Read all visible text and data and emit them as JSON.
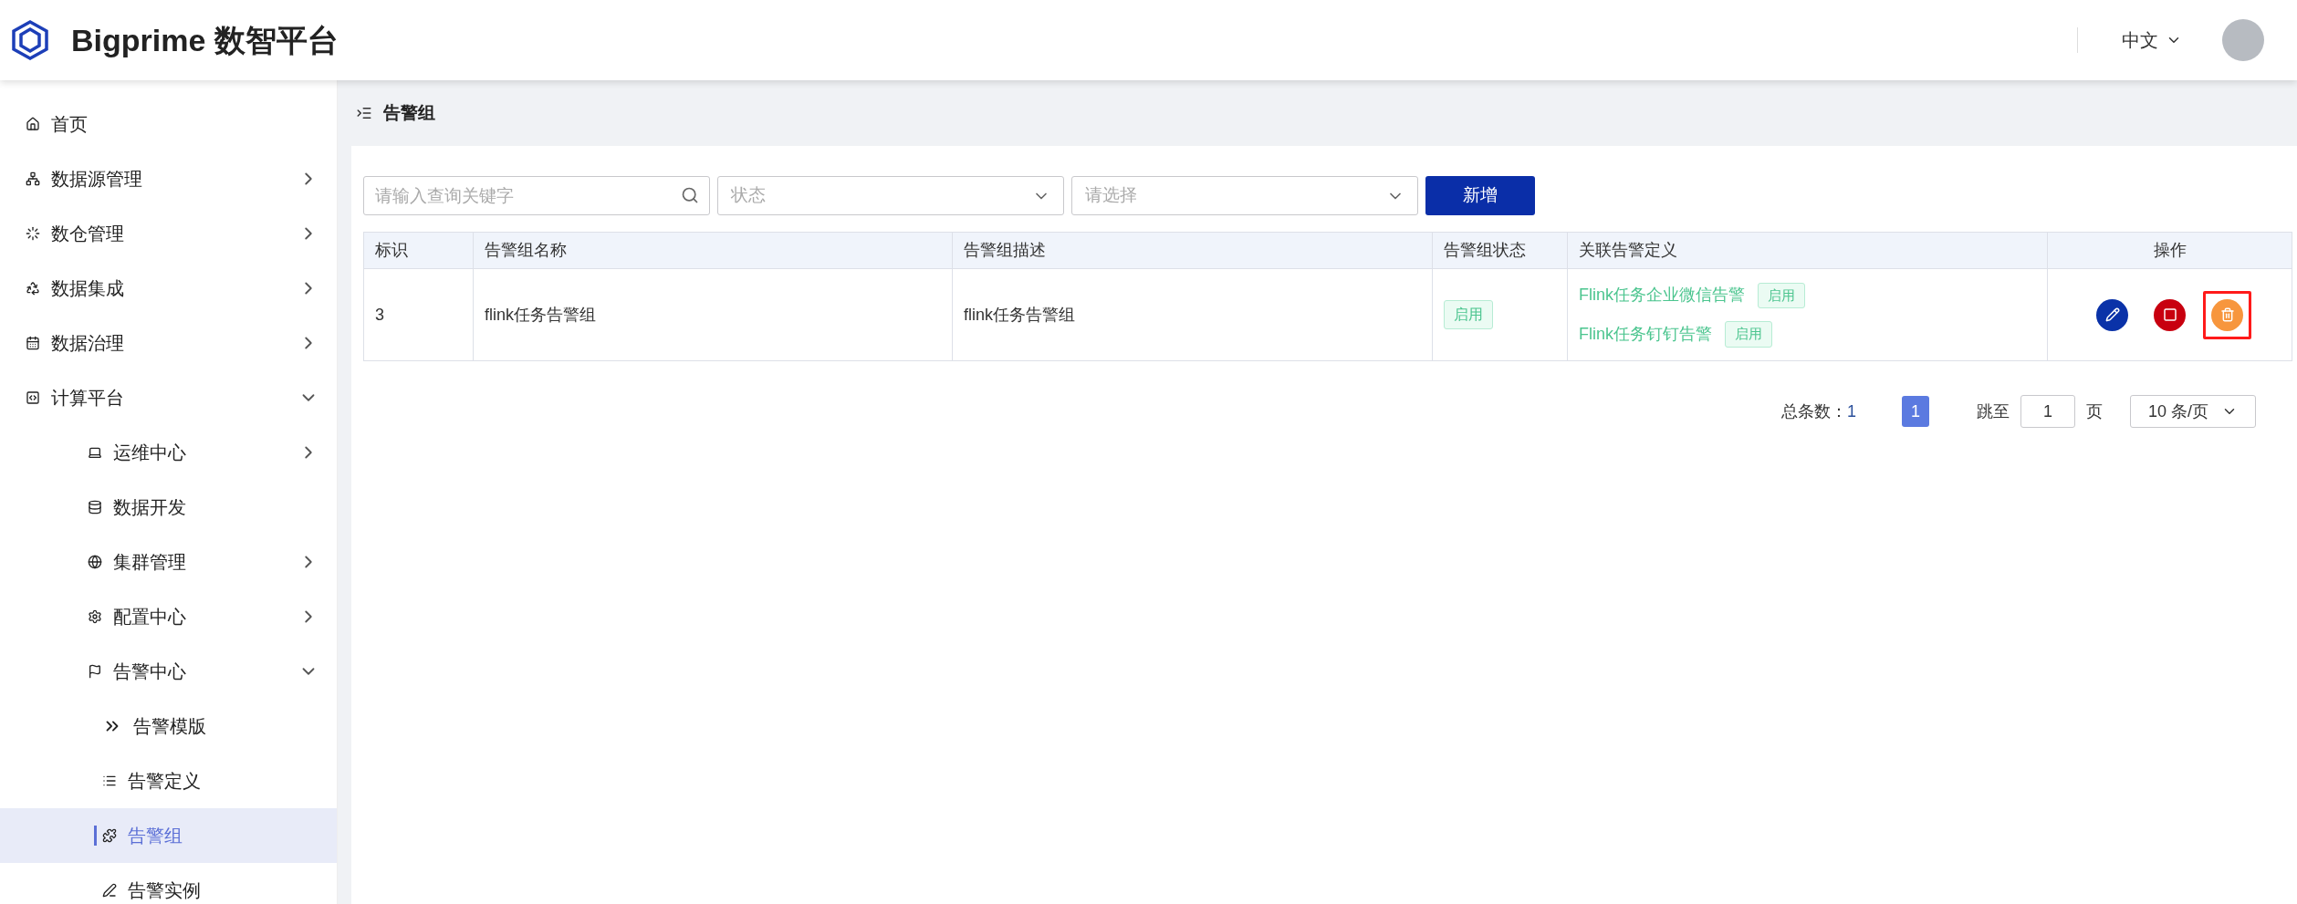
{
  "header": {
    "logo_text": "Bigprime 数智平台",
    "language": "中文"
  },
  "sidebar": {
    "items": [
      {
        "label": "首页",
        "selected": false
      },
      {
        "label": "数据源管理",
        "selected": false,
        "expanded": false
      },
      {
        "label": "数仓管理",
        "selected": false,
        "expanded": false
      },
      {
        "label": "数据集成",
        "selected": false,
        "expanded": false
      },
      {
        "label": "数据治理",
        "selected": false,
        "expanded": false
      },
      {
        "label": "计算平台",
        "selected": false,
        "expanded": true,
        "children": [
          {
            "label": "运维中心",
            "selected": false,
            "expanded": false
          },
          {
            "label": "数据开发",
            "selected": false
          },
          {
            "label": "集群管理",
            "selected": false,
            "expanded": false
          },
          {
            "label": "配置中心",
            "selected": false,
            "expanded": false
          },
          {
            "label": "告警中心",
            "selected": false,
            "expanded": true,
            "children": [
              {
                "label": "告警模版",
                "selected": false
              },
              {
                "label": "告警定义",
                "selected": false
              },
              {
                "label": "告警组",
                "selected": true
              },
              {
                "label": "告警实例",
                "selected": false
              }
            ]
          }
        ]
      }
    ]
  },
  "breadcrumb": {
    "title": "告警组"
  },
  "toolbar": {
    "search": {
      "placeholder": "请输入查询关键字"
    },
    "status_select": {
      "placeholder": "状态"
    },
    "select": {
      "placeholder": "请选择"
    },
    "add_button": "新增"
  },
  "table": {
    "columns": [
      "标识",
      "告警组名称",
      "告警组描述",
      "告警组状态",
      "关联告警定义",
      "操作"
    ],
    "rows": [
      {
        "id": "3",
        "name": "flink任务告警组",
        "description": "flink任务告警组",
        "status": "启用",
        "definitions": [
          {
            "name": "Flink任务企业微信告警",
            "status": "启用"
          },
          {
            "name": "Flink任务钉钉告警",
            "status": "启用"
          }
        ],
        "actions": [
          {
            "kind": "edit",
            "highlighted": false
          },
          {
            "kind": "stop",
            "highlighted": false
          },
          {
            "kind": "delete",
            "highlighted": true
          }
        ]
      }
    ]
  },
  "pagination": {
    "total_label": "总条数：",
    "total": "1",
    "pages": [
      {
        "label": "1",
        "selected": true
      }
    ],
    "jump_label": "跳至",
    "jump_value": "1",
    "page_suffix": "页",
    "page_size": "10 条/页"
  }
}
